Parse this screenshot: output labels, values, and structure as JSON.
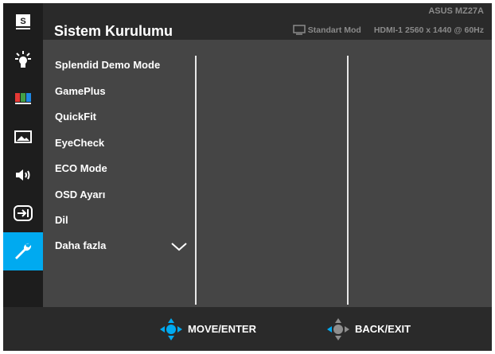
{
  "header": {
    "title": "Sistem Kurulumu",
    "model": "ASUS MZ27A",
    "mode": "Standart Mod",
    "input": "HDMI-1",
    "resolution": "2560 x 1440 @ 60Hz"
  },
  "sidebar": {
    "items": [
      {
        "name": "splendid",
        "icon": "s-splendid-icon"
      },
      {
        "name": "blue-light-filter",
        "icon": "lightbulb-icon"
      },
      {
        "name": "color",
        "icon": "color-bars-icon"
      },
      {
        "name": "image",
        "icon": "image-icon"
      },
      {
        "name": "sound",
        "icon": "speaker-icon"
      },
      {
        "name": "input-select",
        "icon": "input-icon"
      },
      {
        "name": "system-setup",
        "icon": "wrench-icon",
        "active": true
      }
    ],
    "active_color": "#00aaf0"
  },
  "menu": {
    "items": [
      "Splendid Demo Mode",
      "GamePlus",
      "QuickFit",
      "EyeCheck",
      "ECO Mode",
      "OSD Ayarı",
      "Dil",
      "Daha fazla"
    ]
  },
  "footer": {
    "move_label": "MOVE/ENTER",
    "back_label": "BACK/EXIT"
  }
}
